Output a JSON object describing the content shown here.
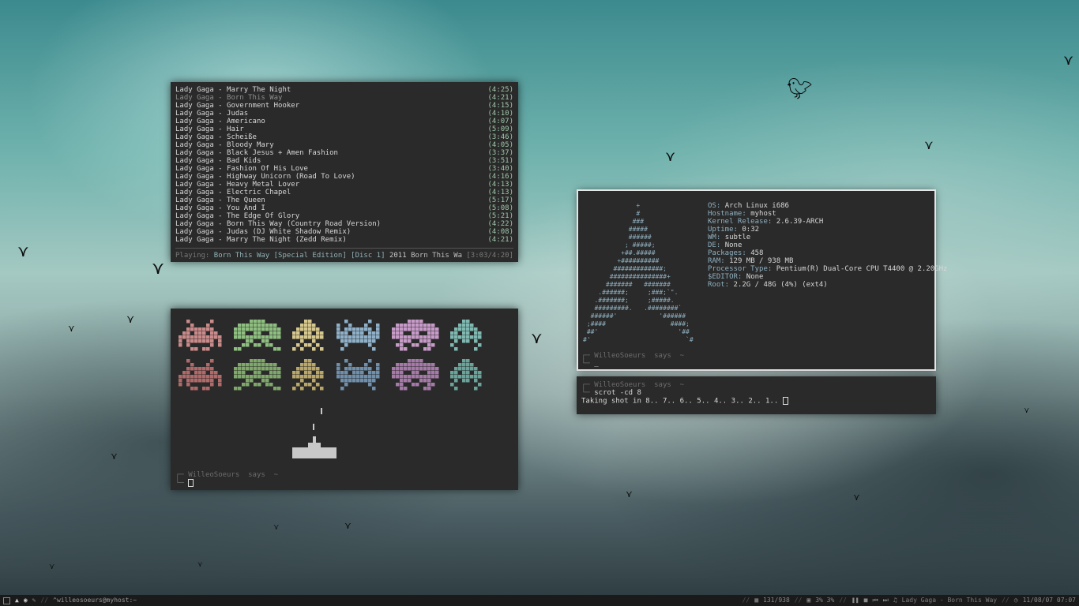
{
  "playlist": {
    "tracks": [
      {
        "title": "Lady Gaga - Marry The Night",
        "duration": "(4:25)"
      },
      {
        "title": "Lady Gaga - Born This Way",
        "duration": "(4:21)"
      },
      {
        "title": "Lady Gaga - Government Hooker",
        "duration": "(4:15)"
      },
      {
        "title": "Lady Gaga - Judas",
        "duration": "(4:10)"
      },
      {
        "title": "Lady Gaga - Americano",
        "duration": "(4:07)"
      },
      {
        "title": "Lady Gaga - Hair",
        "duration": "(5:09)"
      },
      {
        "title": "Lady Gaga - Scheiße",
        "duration": "(3:46)"
      },
      {
        "title": "Lady Gaga - Bloody Mary",
        "duration": "(4:05)"
      },
      {
        "title": "Lady Gaga - Black Jesus + Amen Fashion",
        "duration": "(3:37)"
      },
      {
        "title": "Lady Gaga - Bad Kids",
        "duration": "(3:51)"
      },
      {
        "title": "Lady Gaga - Fashion Of His Love",
        "duration": "(3:40)"
      },
      {
        "title": "Lady Gaga - Highway Unicorn (Road To Love)",
        "duration": "(4:16)"
      },
      {
        "title": "Lady Gaga - Heavy Metal Lover",
        "duration": "(4:13)"
      },
      {
        "title": "Lady Gaga - Electric Chapel",
        "duration": "(4:13)"
      },
      {
        "title": "Lady Gaga - The Queen",
        "duration": "(5:17)"
      },
      {
        "title": "Lady Gaga - You And I",
        "duration": "(5:08)"
      },
      {
        "title": "Lady Gaga - The Edge Of Glory",
        "duration": "(5:21)"
      },
      {
        "title": "Lady Gaga - Born This Way (Country Road Version)",
        "duration": "(4:22)"
      },
      {
        "title": "Lady Gaga - Judas (DJ White Shadow Remix)",
        "duration": "(4:08)"
      },
      {
        "title": "Lady Gaga - Marry The Night (Zedd Remix)",
        "duration": "(4:21)"
      }
    ],
    "now_playing": {
      "label": "Playing:",
      "album": "Born This Way [Special Edition] [Disc 1]",
      "year": "2011",
      "title": "Born This Wa",
      "time": "[3:03/4:20]"
    }
  },
  "invaders": {
    "colors_top": [
      "#c98a8a",
      "#8fbf80",
      "#d6c78e",
      "#8fb0c8",
      "#c79bc8",
      "#7fb8b0"
    ],
    "colors_bottom": [
      "#b06a6a",
      "#7fa86a",
      "#b8a66a",
      "#6f8fab",
      "#a57aa8",
      "#6aa39a"
    ],
    "ship_color": "#c8c8c8",
    "prompt_user": "WilleoSoeurs",
    "prompt_says": "says",
    "prompt_dir": "~"
  },
  "sysinfo": {
    "rows": [
      {
        "k": "OS:",
        "v": "Arch Linux i686"
      },
      {
        "k": "Hostname:",
        "v": "myhost"
      },
      {
        "k": "Kernel Release:",
        "v": "2.6.39-ARCH"
      },
      {
        "k": "Uptime:",
        "v": "0:32"
      },
      {
        "k": "WM:",
        "v": "subtle"
      },
      {
        "k": "DE:",
        "v": "None"
      },
      {
        "k": "Packages:",
        "v": "458"
      },
      {
        "k": "RAM:",
        "v": "129 MB / 938 MB"
      },
      {
        "k": "Processor Type:",
        "v": "Pentium(R) Dual-Core CPU T4400 @ 2.20GHz"
      },
      {
        "k": "$EDITOR:",
        "v": "None"
      },
      {
        "k": "Root:",
        "v": "2.2G / 48G (4%) (ext4)"
      }
    ],
    "ascii": "              +\n              #\n             ###\n            #####\n            ######\n           ; #####;\n          +##.#####\n         +##########\n        #############;\n       ###############+\n      #######   #######\n    .######;     ;###;`\".\n   .#######;     ;#####.\n   #########.   .########`\n  ######'           '######\n ;####                 ####;\n ##'                     '##\n#'                         `#",
    "prompt_user": "WilleoSoeurs",
    "prompt_says": "says",
    "prompt_dir": "~"
  },
  "scrot": {
    "prompt_user": "WilleoSoeurs",
    "prompt_says": "says",
    "prompt_dir": "~",
    "command": "scrot -cd 8",
    "output": "Taking shot in 8.. 7.. 6.. 5.. 4.. 3.. 2.. 1.."
  },
  "statusbar": {
    "window_title": "^willeosoeurs@myhost:~",
    "mem": "131/938",
    "cpu": "3% 3%",
    "music": "Lady Gaga - Born This Way",
    "clock": "11/08/07 07:07"
  }
}
